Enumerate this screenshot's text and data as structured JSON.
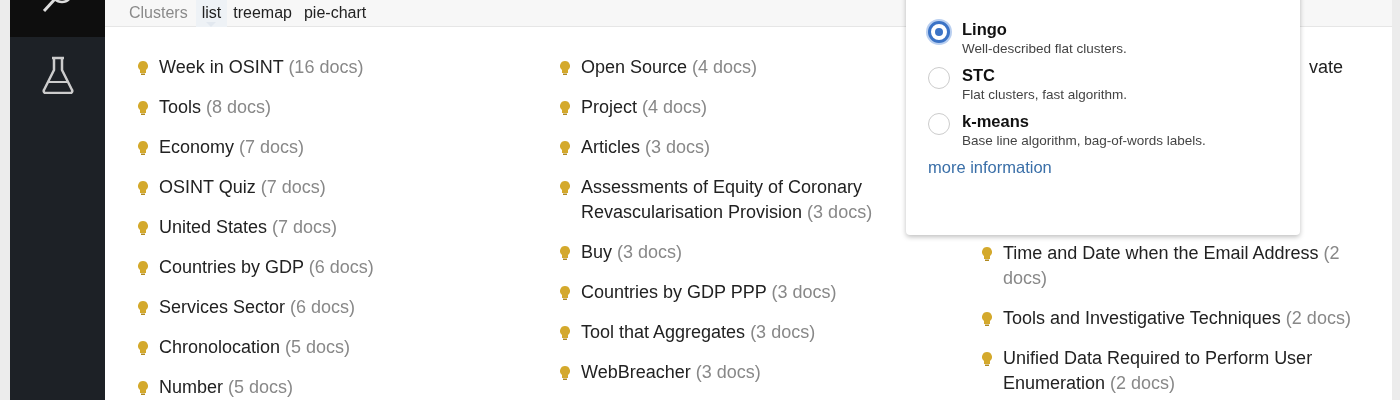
{
  "sidebar": {
    "items": [
      {
        "kind": "search",
        "selected": true
      },
      {
        "kind": "flask",
        "selected": false
      }
    ]
  },
  "view_bar": {
    "label": "Clusters",
    "tabs": [
      {
        "label": "list",
        "selected": true
      },
      {
        "label": "treemap",
        "selected": false
      },
      {
        "label": "pie-chart",
        "selected": false
      }
    ]
  },
  "clusters": {
    "columns": [
      {
        "items": [
          {
            "kind": "cluster",
            "label": "Week in OSINT",
            "count": "(16 docs)"
          },
          {
            "kind": "cluster",
            "label": "Tools",
            "count": "(8 docs)"
          },
          {
            "kind": "cluster",
            "label": "Economy",
            "count": "(7 docs)"
          },
          {
            "kind": "cluster",
            "label": "OSINT Quiz",
            "count": "(7 docs)"
          },
          {
            "kind": "cluster",
            "label": "United States",
            "count": "(7 docs)"
          },
          {
            "kind": "cluster",
            "label": "Countries by GDP",
            "count": "(6 docs)"
          },
          {
            "kind": "cluster",
            "label": "Services Sector",
            "count": "(6 docs)"
          },
          {
            "kind": "cluster",
            "label": "Chronolocation",
            "count": "(5 docs)"
          },
          {
            "kind": "cluster",
            "label": "Number",
            "count": "(5 docs)"
          }
        ]
      },
      {
        "items": [
          {
            "kind": "cluster",
            "label": "Open Source",
            "count": "(4 docs)"
          },
          {
            "kind": "cluster",
            "label": "Project",
            "count": "(4 docs)"
          },
          {
            "kind": "cluster",
            "label": "Articles",
            "count": "(3 docs)"
          },
          {
            "kind": "cluster",
            "label": "Assessments of Equity of Coronary Revascularisation Provision",
            "count": "(3 docs)"
          },
          {
            "kind": "cluster",
            "label": "Buy",
            "count": "(3 docs)"
          },
          {
            "kind": "cluster",
            "label": "Countries by GDP PPP",
            "count": "(3 docs)"
          },
          {
            "kind": "cluster",
            "label": "Tool that Aggregates",
            "count": "(3 docs)"
          },
          {
            "kind": "cluster",
            "label": "WebBreacher",
            "count": "(3 docs)"
          }
        ]
      },
      {
        "items": [
          {
            "kind": "covered",
            "label": "vate"
          },
          {
            "kind": "cluster",
            "label": "Time and Date when the Email Address",
            "count": "(2 docs)"
          },
          {
            "kind": "cluster",
            "label": "Tools and Investigative Techniques",
            "count": "(2 docs)"
          },
          {
            "kind": "cluster",
            "label": "Unified Data Required to Perform User Enumeration",
            "count": "(2 docs)"
          }
        ]
      }
    ]
  },
  "algorithm_menu": {
    "options": [
      {
        "name": "Lingo",
        "description": "Well-described flat clusters.",
        "selected": true
      },
      {
        "name": "STC",
        "description": "Flat clusters, fast algorithm.",
        "selected": false
      },
      {
        "name": "k-means",
        "description": "Base line algorithm, bag-of-words labels.",
        "selected": false
      }
    ],
    "link": "more information"
  }
}
